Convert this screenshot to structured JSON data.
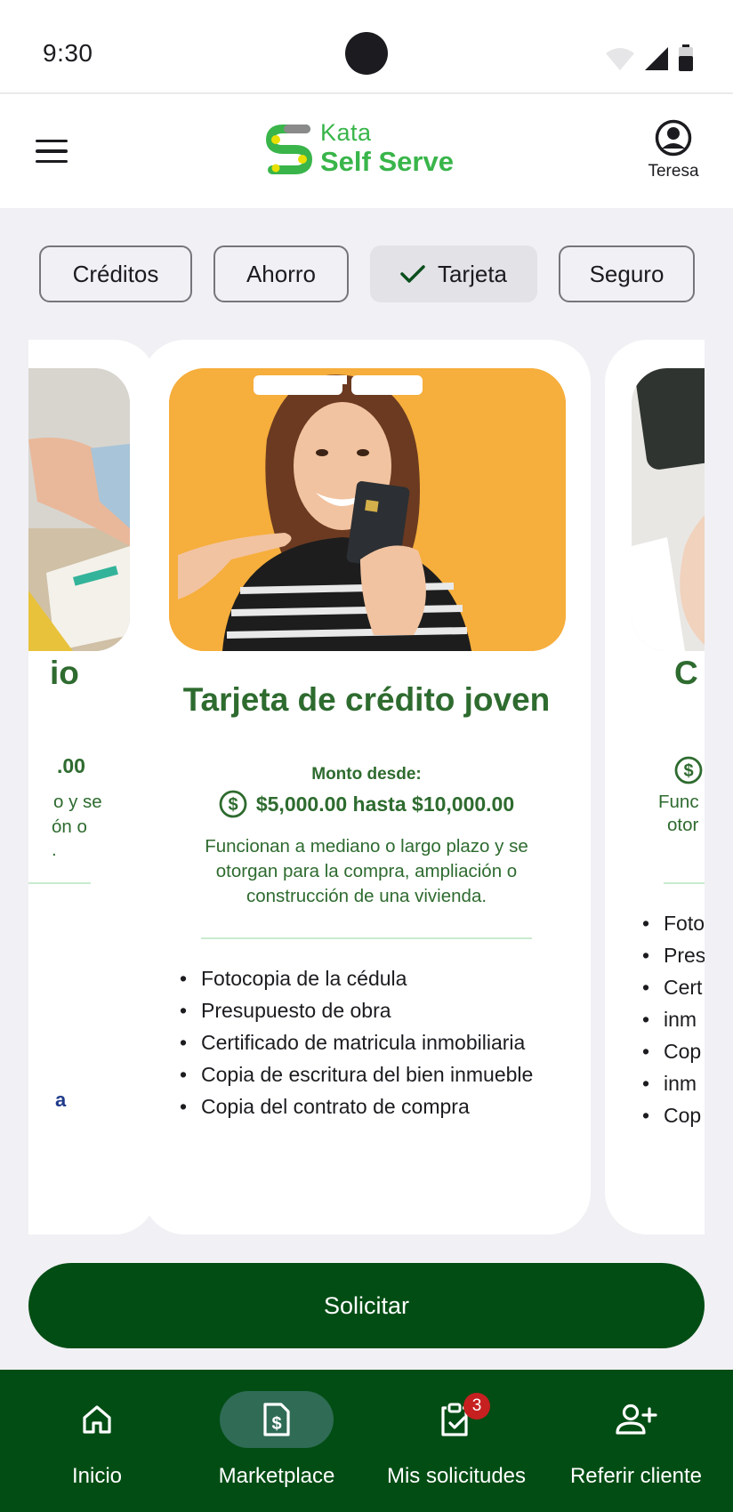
{
  "status_bar": {
    "time": "9:30"
  },
  "app_bar": {
    "logo_line1": "Kata",
    "logo_line2": "Self Serve",
    "user_name": "Teresa"
  },
  "chips": [
    {
      "label": "Créditos",
      "selected": false
    },
    {
      "label": "Ahorro",
      "selected": false
    },
    {
      "label": "Tarjeta",
      "selected": true
    },
    {
      "label": "Seguro",
      "selected": false
    }
  ],
  "main_card": {
    "title": "Tarjeta de crédito joven",
    "amount_label": "Monto desde:",
    "amount_value": "$5,000.00 hasta $10,000.00",
    "description": "Funcionan a mediano o largo plazo y se otorgan para la compra, ampliación o construcción de una vivienda.",
    "requirements": [
      "Fotocopia de la cédula",
      "Presupuesto de obra",
      "Certificado de matricula inmobiliaria",
      "Copia de escritura del bien inmueble",
      "Copia del contrato de compra"
    ]
  },
  "left_card": {
    "title_fragment": "io",
    "amount_fragment": ".00",
    "desc_fragments": [
      "o y se",
      "ón o",
      "."
    ],
    "link_fragment": "a"
  },
  "right_card": {
    "title_fragment": "C",
    "desc_fragments": [
      "Func",
      "otor"
    ],
    "req_fragments": [
      "Foto",
      "Pres",
      "Cert",
      "inm",
      "Cop",
      "inm",
      "Cop"
    ]
  },
  "action": {
    "solicitar_label": "Solicitar"
  },
  "bottom_nav": [
    {
      "label": "Inicio",
      "icon": "home-icon",
      "active": false
    },
    {
      "label": "Marketplace",
      "icon": "document-dollar-icon",
      "active": true
    },
    {
      "label": "Mis solicitudes",
      "icon": "clipboard-check-icon",
      "active": false,
      "badge": "3"
    },
    {
      "label": "Referir cliente",
      "icon": "person-add-icon",
      "active": false
    }
  ],
  "colors": {
    "brand_green": "#39b54a",
    "dark_green": "#024d14",
    "text_green": "#2e6b2f",
    "background": "#f1f0f4",
    "badge_red": "#c62020"
  }
}
